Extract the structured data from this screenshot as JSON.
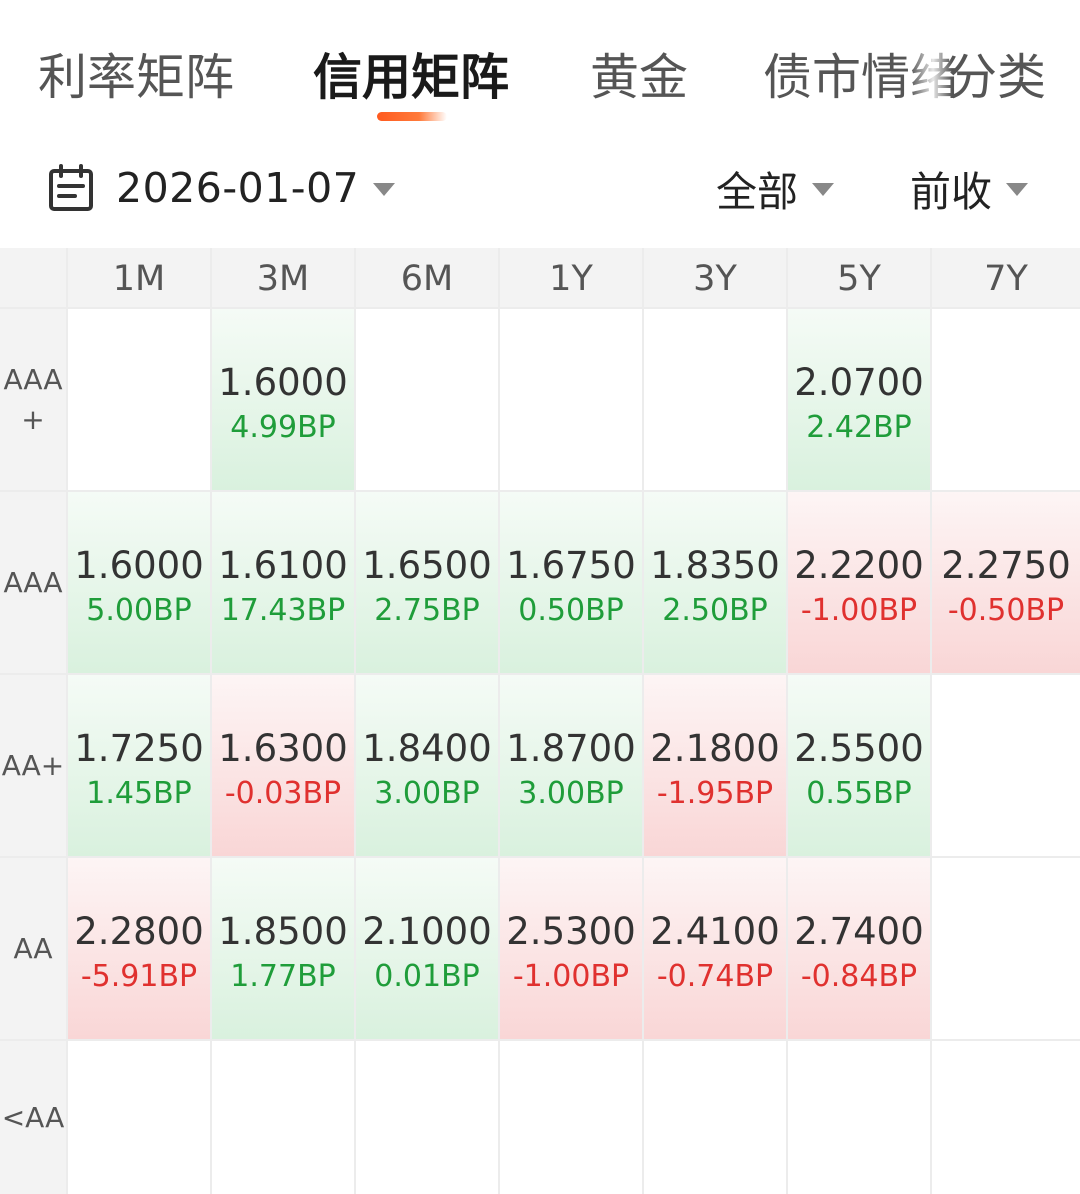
{
  "tabs": [
    {
      "label": "利率矩阵",
      "active": false
    },
    {
      "label": "信用矩阵",
      "active": true
    },
    {
      "label": "黄金",
      "active": false
    },
    {
      "label": "债市情绪",
      "active": false
    },
    {
      "label": "分类",
      "active": false
    }
  ],
  "filter": {
    "date": "2026-01-07",
    "scope": "全部",
    "price_basis": "前收"
  },
  "matrix": {
    "columns": [
      "1M",
      "3M",
      "6M",
      "1Y",
      "3Y",
      "5Y",
      "7Y"
    ],
    "rows": [
      {
        "label_line1": "AAA",
        "label_line2": "+",
        "cells": [
          null,
          {
            "value": "1.6000",
            "change": "4.99BP",
            "dir": "up"
          },
          null,
          null,
          null,
          {
            "value": "2.0700",
            "change": "2.42BP",
            "dir": "up"
          },
          null
        ]
      },
      {
        "label_line1": "AAA",
        "label_line2": "",
        "cells": [
          {
            "value": "1.6000",
            "change": "5.00BP",
            "dir": "up"
          },
          {
            "value": "1.6100",
            "change": "17.43BP",
            "dir": "up"
          },
          {
            "value": "1.6500",
            "change": "2.75BP",
            "dir": "up"
          },
          {
            "value": "1.6750",
            "change": "0.50BP",
            "dir": "up"
          },
          {
            "value": "1.8350",
            "change": "2.50BP",
            "dir": "up"
          },
          {
            "value": "2.2200",
            "change": "-1.00BP",
            "dir": "down"
          },
          {
            "value": "2.2750",
            "change": "-0.50BP",
            "dir": "down"
          }
        ]
      },
      {
        "label_line1": "AA+",
        "label_line2": "",
        "cells": [
          {
            "value": "1.7250",
            "change": "1.45BP",
            "dir": "up"
          },
          {
            "value": "1.6300",
            "change": "-0.03BP",
            "dir": "down"
          },
          {
            "value": "1.8400",
            "change": "3.00BP",
            "dir": "up"
          },
          {
            "value": "1.8700",
            "change": "3.00BP",
            "dir": "up"
          },
          {
            "value": "2.1800",
            "change": "-1.95BP",
            "dir": "down"
          },
          {
            "value": "2.5500",
            "change": "0.55BP",
            "dir": "up"
          },
          null
        ]
      },
      {
        "label_line1": "AA",
        "label_line2": "",
        "cells": [
          {
            "value": "2.2800",
            "change": "-5.91BP",
            "dir": "down"
          },
          {
            "value": "1.8500",
            "change": "1.77BP",
            "dir": "up"
          },
          {
            "value": "2.1000",
            "change": "0.01BP",
            "dir": "up"
          },
          {
            "value": "2.5300",
            "change": "-1.00BP",
            "dir": "down"
          },
          {
            "value": "2.4100",
            "change": "-0.74BP",
            "dir": "down"
          },
          {
            "value": "2.7400",
            "change": "-0.84BP",
            "dir": "down"
          },
          null
        ]
      },
      {
        "label_line1": "<AA",
        "label_line2": "",
        "cells": [
          null,
          null,
          null,
          null,
          null,
          null,
          null
        ]
      }
    ]
  },
  "colors": {
    "accent": "#ff5a1f",
    "up": "#1f9d3a",
    "down": "#e0312f",
    "up_bg": "#d9f1de",
    "down_bg": "#f9d6d6"
  },
  "icons": {
    "date": "calendar-icon",
    "dropdown": "caret-down-icon"
  }
}
